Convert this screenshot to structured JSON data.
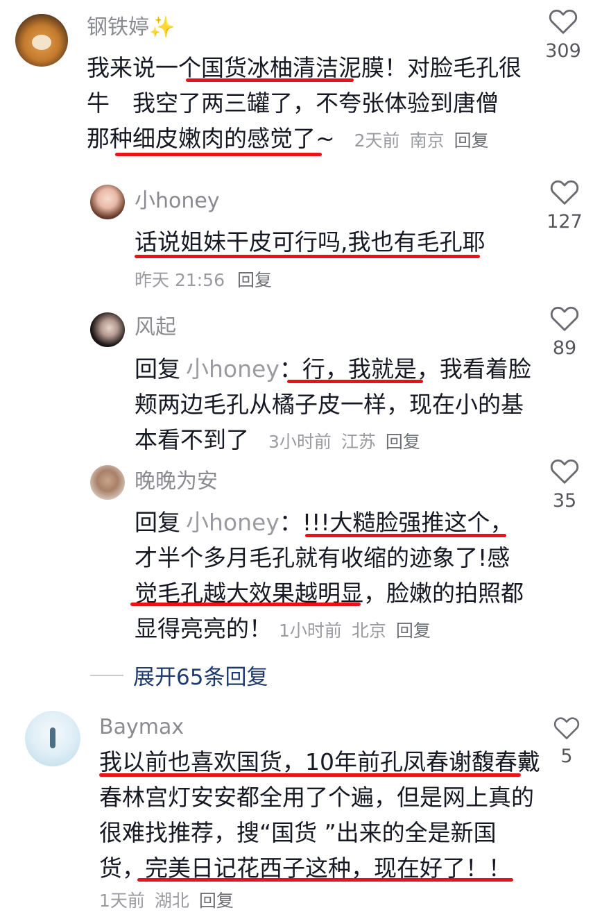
{
  "comments": [
    {
      "user": "钢铁婷✨",
      "lines": [
        "我来说一个国货冰柚清洁泥膜！对脸毛孔很",
        "牛　我空了两三罐了，不夸张体验到唐僧",
        "那种细皮嫩肉的感觉了~"
      ],
      "time": "2天前",
      "location": "南京",
      "reply": "回复",
      "likes": "309"
    },
    {
      "user": "小honey",
      "lines": [
        "话说姐妹干皮可行吗,我也有毛孔耶"
      ],
      "meta_line": "昨天 21:56",
      "reply": "回复",
      "likes": "127"
    },
    {
      "user": "风起",
      "reply_prefix": "回复",
      "reply_to": "小honey",
      "lines": [
        "：行，我就是，我看着脸",
        "颊两边毛孔从橘子皮一样，现在小的基",
        "本看不到了"
      ],
      "time": "3小时前",
      "location": "江苏",
      "reply": "回复",
      "likes": "89"
    },
    {
      "user": "晚晚为安",
      "reply_prefix": "回复",
      "reply_to": "小honey",
      "lines": [
        "：!!!大糙脸强推这个，",
        "才半个多月毛孔就有收缩的迹象了!感",
        "觉毛孔越大效果越明显，脸嫩的拍照都",
        "显得亮亮的！"
      ],
      "time": "1小时前",
      "location": "北京",
      "reply": "回复",
      "likes": "35"
    },
    {
      "user": "Baymax",
      "lines": [
        "我以前也喜欢国货，10年前孔凤春谢馥春戴",
        "春林宫灯安安都全用了个遍，但是网上真的",
        "很难找推荐，搜“国货 ”出来的全是新国",
        "货，完美日记花西子这种，现在好了！！"
      ],
      "time": "1天前",
      "location": "湖北",
      "reply": "回复",
      "likes": "5"
    }
  ],
  "expand_label": "展开65条回复",
  "colors": {
    "underline": "#e8121a",
    "expand": "#1e3a6e",
    "username": "#8a8b91"
  }
}
